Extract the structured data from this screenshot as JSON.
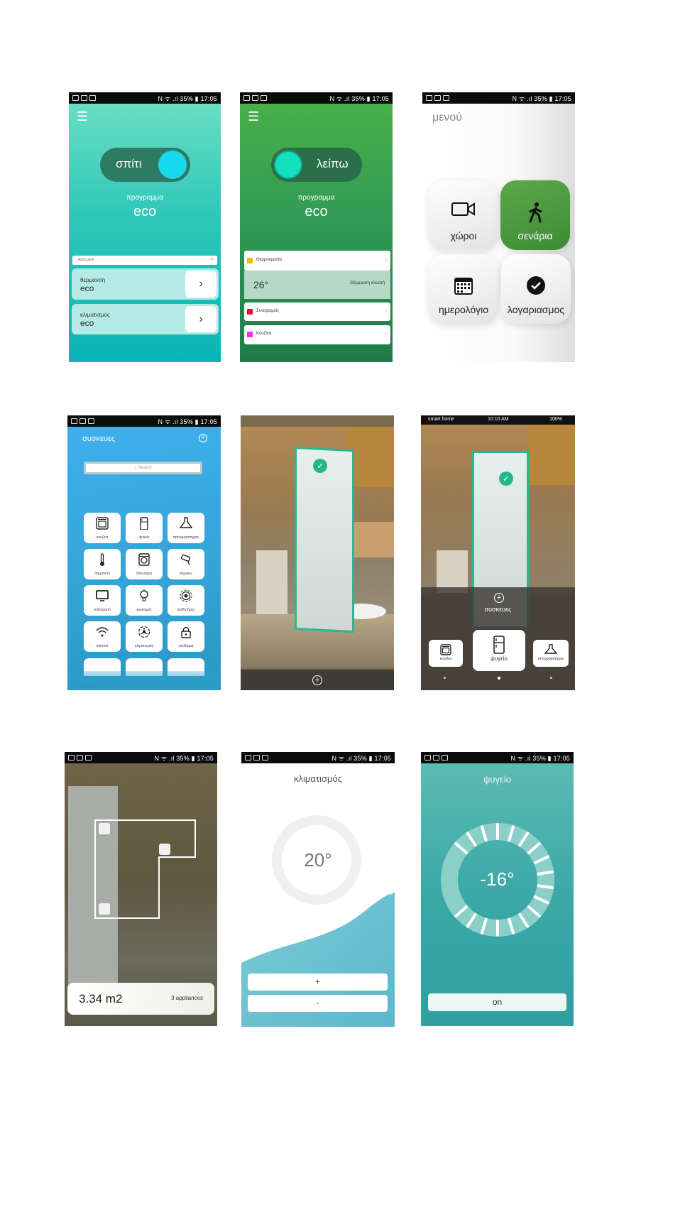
{
  "status_bar": {
    "left_icons": "▶ ▣ ▣ ...",
    "right": "N ᯤ .ıl 35% ▮ 17:05"
  },
  "s1": {
    "toggle_label": "σπίτι",
    "program_label": "προγραμμα",
    "program_value": "eco",
    "add_label_text": "Add Label",
    "rows": [
      {
        "title": "θερμανση",
        "value": "eco"
      },
      {
        "title": "κλιματισμος",
        "value": "eco"
      }
    ],
    "colors": {
      "top": "#6fe0c4",
      "bottom": "#0ab4b6",
      "knob": "#19d9ef",
      "toggle": "#2f7a62"
    }
  },
  "s2": {
    "toggle_label": "λείπω",
    "program_label": "προγραμμα",
    "program_value": "eco",
    "rows": [
      {
        "name": "Θερμοκρασία",
        "color": "#f5b800"
      },
      {
        "name": "Συναγερμός",
        "color": "#e8102a"
      },
      {
        "name": "Κουζίνα",
        "color": "#ff2be0"
      }
    ],
    "temp_value": "26°",
    "heating_status": "Θέρμανση κλειστή"
  },
  "s3": {
    "title": "μενού",
    "tiles": [
      {
        "label": "χώροι",
        "icon": "video-camera-icon"
      },
      {
        "label": "σενάρια",
        "icon": "walking-person-icon"
      },
      {
        "label": "ημερολόγιο",
        "icon": "calendar-icon"
      },
      {
        "label": "λογαριασμος",
        "icon": "check-circle-icon"
      }
    ],
    "accent": "#4a9a3f"
  },
  "s4": {
    "title": "συσκευες",
    "search_placeholder": "Search",
    "apps": [
      {
        "label": "κουζίνα",
        "icon": "oven-icon"
      },
      {
        "label": "ψυγείο",
        "icon": "fridge-icon"
      },
      {
        "label": "απορροφητήρας",
        "icon": "hood-icon"
      },
      {
        "label": "θέρμανση",
        "icon": "thermometer-icon"
      },
      {
        "label": "πλυντήριο",
        "icon": "washer-icon"
      },
      {
        "label": "κάμερες",
        "icon": "camera-icon"
      },
      {
        "label": "τηλεόραση",
        "icon": "tv-icon"
      },
      {
        "label": "φωτισμός",
        "icon": "bulb-icon"
      },
      {
        "label": "αισθητήρες",
        "icon": "sensor-icon"
      },
      {
        "label": "internet",
        "icon": "wifi-icon"
      },
      {
        "label": "κλιματισμός",
        "icon": "fan-icon"
      },
      {
        "label": "κλειδαριά",
        "icon": "lock-icon"
      }
    ]
  },
  "s6": {
    "carrier": "smart home",
    "time": "10:10 AM",
    "battery": "100%",
    "devices_label": "συσκευες",
    "cards": [
      {
        "label": "κουζίνα",
        "icon": "oven-icon"
      },
      {
        "label": "ψυγείο",
        "icon": "fridge-icon"
      },
      {
        "label": "απορροφητήρας",
        "icon": "hood-icon"
      }
    ]
  },
  "s7": {
    "area": "3.34 m2",
    "appliances": "3 appliances"
  },
  "s8": {
    "title": "κλιματισμός",
    "temp": "20°",
    "plus": "+",
    "minus": "-"
  },
  "s9": {
    "title": "ψυγείο",
    "temp": "-16°",
    "on_label": "on"
  }
}
